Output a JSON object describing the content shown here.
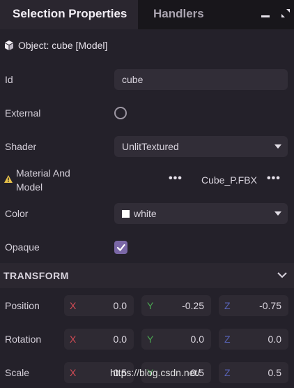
{
  "tabs": {
    "active": "Selection Properties",
    "inactive": "Handlers"
  },
  "object_header": {
    "text": "Object: cube [Model]"
  },
  "fields": {
    "id": {
      "label": "Id",
      "value": "cube"
    },
    "external": {
      "label": "External",
      "checked": false
    },
    "shader": {
      "label": "Shader",
      "value": "UnlitTextured"
    },
    "material": {
      "label_line1": "Material And",
      "label_line2": "Model",
      "value": "Cube_P.FBX"
    },
    "color": {
      "label": "Color",
      "value": "white",
      "swatch": "#ffffff"
    },
    "opaque": {
      "label": "Opaque",
      "checked": true
    }
  },
  "transform": {
    "title": "TRANSFORM",
    "rows": [
      {
        "label": "Position",
        "x": "0.0",
        "y": "-0.25",
        "z": "-0.75"
      },
      {
        "label": "Rotation",
        "x": "0.0",
        "y": "0.0",
        "z": "0.0"
      },
      {
        "label": "Scale",
        "x": "0.5",
        "y": "0.5",
        "z": "0.5"
      }
    ],
    "axes": {
      "x": "X",
      "y": "Y",
      "z": "Z"
    }
  },
  "watermark": "https://blog.csdn.net/",
  "colors": {
    "accent": "#7a67a6",
    "x_axis": "#d24b55",
    "y_axis": "#4aa451",
    "z_axis": "#5863b6"
  }
}
